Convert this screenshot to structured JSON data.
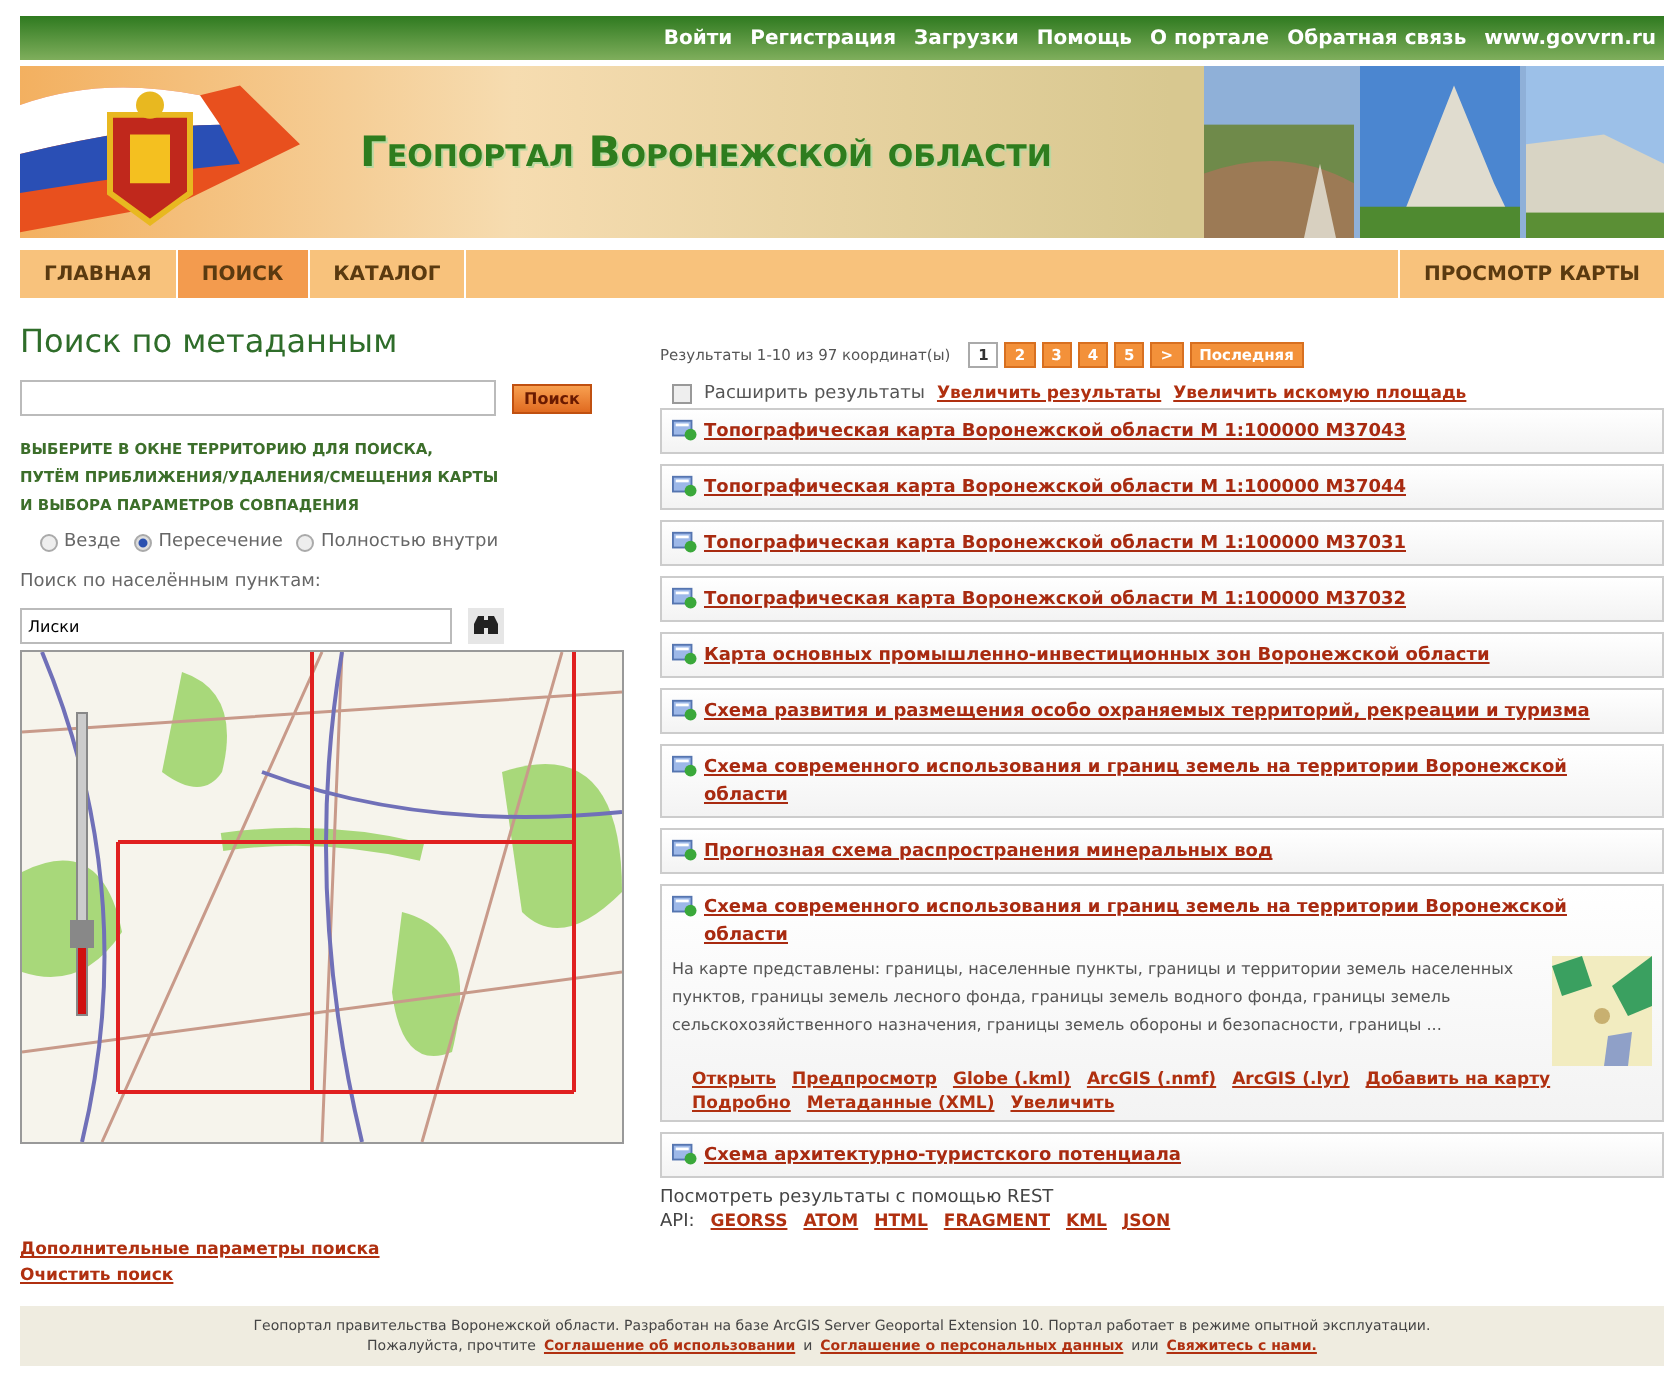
{
  "top_links": [
    "Войти",
    "Регистрация",
    "Загрузки",
    "Помощь",
    "О портале",
    "Обратная связь",
    "www.govvrn.ru"
  ],
  "header": {
    "title": "Геопортал Воронежской области"
  },
  "nav": {
    "left": [
      {
        "label": "ГЛАВНАЯ",
        "selected": false
      },
      {
        "label": "ПОИСК",
        "selected": true
      },
      {
        "label": "КАТАЛОГ",
        "selected": false
      }
    ],
    "right": [
      {
        "label": "ПРОСМОТР КАРТЫ",
        "selected": false
      }
    ]
  },
  "search": {
    "heading": "Поиск по метаданным",
    "button": "Поиск",
    "instructions": [
      "ВЫБЕРИТЕ В ОКНЕ ТЕРРИТОРИЮ ДЛЯ ПОИСКА,",
      "ПУТЁМ ПРИБЛИЖЕНИЯ/УДАЛЕНИЯ/СМЕЩЕНИЯ КАРТЫ",
      "И ВЫБОРА ПАРАМЕТРОВ СОВПАДЕНИЯ"
    ],
    "radios": [
      {
        "label": "Везде",
        "selected": false
      },
      {
        "label": "Пересечение",
        "selected": true
      },
      {
        "label": "Полностью внутри",
        "selected": false
      }
    ],
    "place_label": "Поиск по населённым пунктам:",
    "place_value": "Лиски",
    "map": {
      "kind": "picture",
      "zoom": {
        "level": 0.27
      }
    },
    "links": [
      "Дополнительные параметры поиска",
      "Очистить поиск"
    ]
  },
  "results": {
    "summary": "Результаты 1-10 из 97 координат(ы)",
    "pages": [
      {
        "label": "1",
        "selected": true
      },
      {
        "label": "2",
        "selected": false
      },
      {
        "label": "3",
        "selected": false
      },
      {
        "label": "4",
        "selected": false
      },
      {
        "label": "5",
        "selected": false
      },
      {
        "label": ">",
        "selected": false
      },
      {
        "label": "Последняя",
        "selected": false
      }
    ],
    "expand": {
      "label": "Расширить результаты",
      "checked": false
    },
    "actions": [
      "Увеличить результаты",
      "Увеличить искомую площадь"
    ],
    "items": [
      {
        "title": "Топографическая карта Воронежской области М 1:100000 М37043"
      },
      {
        "title": "Топографическая карта Воронежской области М 1:100000 М37044"
      },
      {
        "title": "Топографическая карта Воронежской области М 1:100000 М37031"
      },
      {
        "title": "Топографическая карта Воронежской области М 1:100000 М37032"
      },
      {
        "title": "Карта основных промышленно-инвестиционных зон Воронежской области"
      },
      {
        "title": "Схема развития и размещения особо охраняемых территорий, рекреации и туризма"
      },
      {
        "title": "Схема современного использования и границ земель на территории Воронежской области"
      },
      {
        "title": "Прогнозная схема распространения минеральных вод"
      },
      {
        "title": "Схема современного использования и границ земель на территории Воронежской области",
        "description": "На карте представлены: границы, населенные пункты, границы и территории земель населенных пунктов, границы земель лесного фонда, границы земель водного фонда, границы земель сельскохозяйственного назначения, границы земель обороны и безопасности, границы ...",
        "thumbnail": {
          "kind": "picture"
        },
        "links": [
          "Открыть",
          "Предпросмотр",
          "Globe (.kml)",
          "ArcGIS (.nmf)",
          "ArcGIS (.lyr)",
          "Добавить на карту",
          "Подробно",
          "Метаданные (XML)",
          "Увеличить"
        ]
      },
      {
        "title": "Схема архитектурно-туристского потенциала"
      }
    ],
    "rest_label": "Посмотреть результаты с помощью REST",
    "api_label": "API:",
    "api_links": [
      "GEORSS",
      "ATOM",
      "HTML",
      "FRAGMENT",
      "KML",
      "JSON"
    ]
  },
  "footer": {
    "line1": "Геопортал правительства Воронежской области. Разработан на базе ArcGIS Server Geoportal Extension 10. Портал работает в режиме опытной эксплуатации.",
    "line2": [
      {
        "kind": "text",
        "text": "Пожалуйста, прочтите"
      },
      {
        "kind": "link",
        "text": "Соглашение об использовании"
      },
      {
        "kind": "text",
        "text": "и"
      },
      {
        "kind": "link",
        "text": "Соглашение о персональных данных"
      },
      {
        "kind": "text",
        "text": "или"
      },
      {
        "kind": "link",
        "text": "Свяжитесь с нами."
      }
    ]
  }
}
